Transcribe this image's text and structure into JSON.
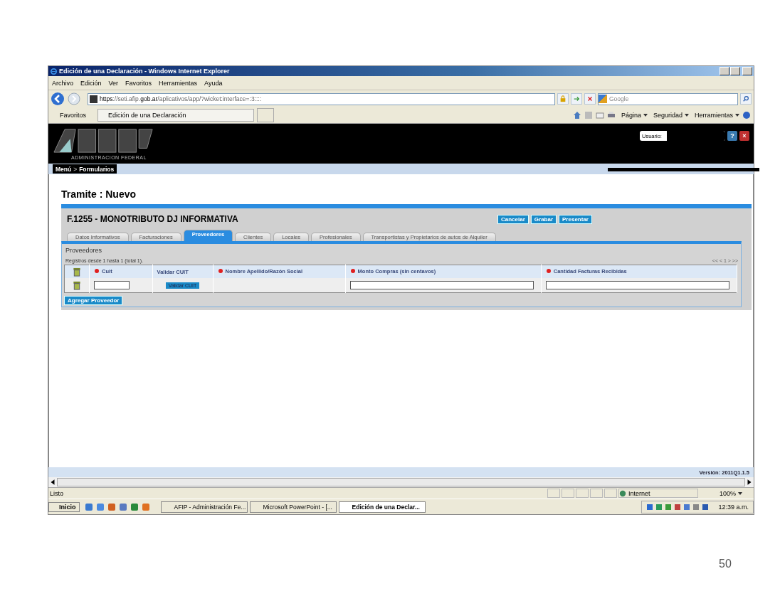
{
  "window": {
    "title": "Edición de una Declaración - Windows Internet Explorer"
  },
  "menubar": [
    "Archivo",
    "Edición",
    "Ver",
    "Favoritos",
    "Herramientas",
    "Ayuda"
  ],
  "address": {
    "url": "**https**://seti.afip.**gob.ar**/aplicativos/app/?wicket:interface=:3::::",
    "search_placeholder": "Google"
  },
  "favorites": {
    "label": "Favoritos",
    "tab": "Edición de una Declaración",
    "commands": [
      "Página",
      "Seguridad",
      "Herramientas"
    ]
  },
  "site": {
    "org": "ADMINISTRACION FEDERAL",
    "user_label": "Usuario:",
    "help": "?",
    "close": "×",
    "breadcrumb": [
      "Menú",
      "Formularios"
    ],
    "separator": ">"
  },
  "page_title": "Tramite : Nuevo",
  "form": {
    "title": "F.1255 - MONOTRIBUTO DJ INFORMATIVA",
    "buttons": [
      "Cancelar",
      "Grabar",
      "Presentar"
    ],
    "tabs": [
      {
        "label": "Datos Informativos",
        "selected": false
      },
      {
        "label": "Facturaciones",
        "selected": false
      },
      {
        "label": "Proveedores",
        "selected": true
      },
      {
        "label": "Clientes",
        "selected": false
      },
      {
        "label": "Locales",
        "selected": false
      },
      {
        "label": "Profesionales",
        "selected": false
      },
      {
        "label": "Transportistas y Propietarios de autos de Alquiler",
        "selected": false
      }
    ],
    "section": "Proveedores",
    "records": "Registros desde 1 hasta 1 (total 1).",
    "pager": "<< < 1 > >>",
    "columns": [
      {
        "kind": "delete"
      },
      {
        "label": "Cuit",
        "required": true
      },
      {
        "label": "Validar CUIT",
        "required": false
      },
      {
        "label": "Nombre Apellido/Razón Social",
        "required": true
      },
      {
        "label": "Monto Compras (sin centavos)",
        "required": true
      },
      {
        "label": "Cantidad Facturas Recibidas",
        "required": true
      }
    ],
    "rows": [
      {
        "cells": [
          {
            "kind": "delete"
          },
          {
            "kind": "input"
          },
          {
            "kind": "button",
            "label": "Validar CUIT"
          },
          {
            "kind": "text"
          },
          {
            "kind": "input"
          },
          {
            "kind": "input"
          }
        ]
      }
    ],
    "add_button": "Agregar Proveedor"
  },
  "version": "Versión: 2011Q1.1.5",
  "status": {
    "text": "Listo",
    "zone": "Internet",
    "zoom": "100%"
  },
  "taskbar": {
    "start": "Inicio",
    "tasks": [
      {
        "label": "AFIP - Administración Fe...",
        "selected": false
      },
      {
        "label": "Microsoft PowerPoint - [...",
        "selected": false
      },
      {
        "label": "Edición de una Declar...",
        "selected": true
      }
    ],
    "clock": "12:39 a.m."
  },
  "slide_number": "50"
}
